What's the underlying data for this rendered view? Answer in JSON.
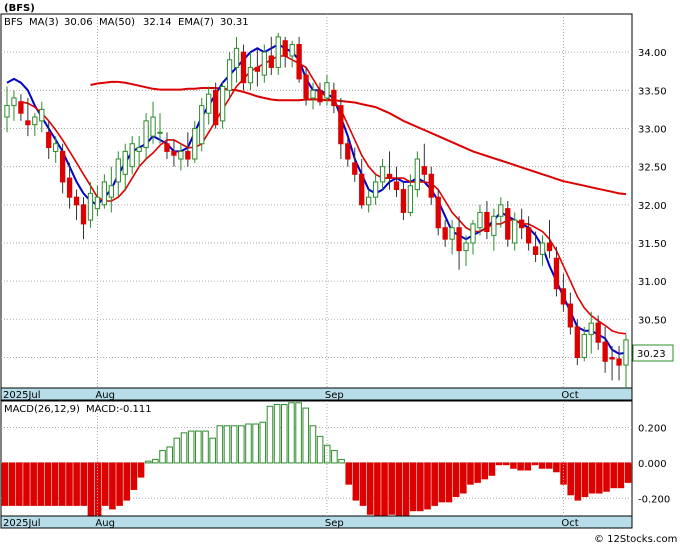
{
  "header": {
    "symbol": "(BFS)",
    "legend_symbol": "BFS",
    "ma3_label": "MA(3)",
    "ma3_value": "30.06",
    "ma50_label": "MA(50)",
    "ma50_value": "32.14",
    "ema7_label": "EMA(7)",
    "ema7_value": "30.31"
  },
  "last_price_label": "30.23",
  "watermark": "© 12Stocks.com",
  "colors": {
    "up": "#2e8b2e",
    "down": "#dd0000",
    "ma3": "#0000cc",
    "ma50": "#dd0000",
    "ema7": "#dd0000",
    "axisband": "#b7dde8",
    "grid": "#aaaaaa"
  },
  "macd_panel": {
    "title": "MACD(26,12,9)",
    "value_label": "MACD:-0.111"
  },
  "chart_data": [
    {
      "type": "candlestick",
      "title": "(BFS)",
      "ylim": [
        29.6,
        34.5
      ],
      "y_ticks": [
        "34.00",
        "33.50",
        "33.00",
        "32.50",
        "32.00",
        "31.50",
        "31.00",
        "30.50",
        "30.00"
      ],
      "x_labels": [
        "2025Jul",
        "Aug",
        "Sep",
        "Oct"
      ],
      "x_label_index": [
        0,
        13,
        46,
        80
      ],
      "grid": "dotted",
      "ohlc": [
        [
          33.15,
          33.55,
          32.95,
          33.3
        ],
        [
          33.3,
          33.5,
          33.1,
          33.4
        ],
        [
          33.35,
          33.45,
          33.1,
          33.2
        ],
        [
          33.1,
          33.4,
          32.9,
          33.05
        ],
        [
          33.05,
          33.2,
          32.9,
          33.15
        ],
        [
          33.1,
          33.35,
          32.95,
          33.25
        ],
        [
          32.95,
          33.1,
          32.6,
          32.75
        ],
        [
          32.7,
          32.9,
          32.55,
          32.8
        ],
        [
          32.7,
          32.8,
          32.15,
          32.3
        ],
        [
          32.35,
          32.55,
          31.95,
          32.1
        ],
        [
          32.1,
          32.2,
          31.8,
          32.0
        ],
        [
          32.0,
          32.1,
          31.55,
          31.75
        ],
        [
          31.8,
          32.3,
          31.7,
          32.15
        ],
        [
          31.95,
          32.25,
          31.85,
          32.1
        ],
        [
          32.0,
          32.4,
          31.95,
          32.3
        ],
        [
          32.1,
          32.5,
          31.9,
          32.25
        ],
        [
          32.3,
          32.7,
          32.1,
          32.6
        ],
        [
          32.4,
          32.8,
          32.2,
          32.7
        ],
        [
          32.5,
          32.9,
          32.4,
          32.8
        ],
        [
          32.7,
          32.9,
          32.5,
          32.75
        ],
        [
          32.75,
          33.2,
          32.6,
          33.1
        ],
        [
          32.9,
          33.35,
          32.8,
          33.15
        ],
        [
          32.95,
          33.2,
          32.8,
          32.95
        ],
        [
          32.8,
          32.95,
          32.6,
          32.7
        ],
        [
          32.7,
          32.85,
          32.5,
          32.65
        ],
        [
          32.6,
          32.8,
          32.45,
          32.7
        ],
        [
          32.7,
          32.95,
          32.5,
          32.6
        ],
        [
          32.6,
          33.1,
          32.55,
          33.0
        ],
        [
          32.8,
          33.4,
          32.7,
          33.3
        ],
        [
          33.2,
          33.55,
          33.05,
          33.45
        ],
        [
          33.5,
          33.6,
          33.0,
          33.05
        ],
        [
          33.1,
          33.6,
          33.0,
          33.55
        ],
        [
          33.5,
          34.0,
          33.4,
          33.9
        ],
        [
          33.8,
          34.2,
          33.6,
          34.05
        ],
        [
          34.0,
          34.1,
          33.5,
          33.6
        ],
        [
          33.6,
          34.0,
          33.5,
          33.8
        ],
        [
          33.8,
          34.05,
          33.55,
          33.75
        ],
        [
          33.7,
          34.1,
          33.6,
          34.0
        ],
        [
          33.95,
          34.2,
          33.7,
          33.8
        ],
        [
          33.8,
          34.25,
          33.7,
          34.2
        ],
        [
          34.15,
          34.2,
          33.8,
          33.95
        ],
        [
          33.95,
          34.15,
          33.8,
          34.1
        ],
        [
          34.1,
          34.2,
          33.6,
          33.65
        ],
        [
          33.7,
          33.8,
          33.3,
          33.4
        ],
        [
          33.4,
          33.6,
          33.25,
          33.5
        ],
        [
          33.5,
          33.6,
          33.3,
          33.35
        ],
        [
          33.4,
          33.7,
          33.3,
          33.6
        ],
        [
          33.5,
          33.6,
          33.2,
          33.3
        ],
        [
          33.3,
          33.4,
          32.6,
          32.8
        ],
        [
          32.8,
          32.9,
          32.5,
          32.6
        ],
        [
          32.55,
          32.75,
          32.3,
          32.4
        ],
        [
          32.4,
          32.6,
          31.95,
          32.0
        ],
        [
          32.0,
          32.2,
          31.9,
          32.1
        ],
        [
          32.1,
          32.4,
          32.0,
          32.3
        ],
        [
          32.3,
          32.6,
          32.2,
          32.5
        ],
        [
          32.4,
          32.7,
          32.2,
          32.35
        ],
        [
          32.3,
          32.5,
          32.1,
          32.2
        ],
        [
          32.2,
          32.3,
          31.8,
          31.9
        ],
        [
          31.9,
          32.4,
          31.85,
          32.25
        ],
        [
          32.2,
          32.7,
          32.1,
          32.6
        ],
        [
          32.5,
          32.8,
          32.3,
          32.4
        ],
        [
          32.4,
          32.5,
          32.0,
          32.1
        ],
        [
          32.1,
          32.2,
          31.6,
          31.7
        ],
        [
          31.7,
          31.8,
          31.45,
          31.55
        ],
        [
          31.55,
          31.8,
          31.35,
          31.7
        ],
        [
          31.7,
          31.85,
          31.15,
          31.4
        ],
        [
          31.4,
          31.6,
          31.2,
          31.5
        ],
        [
          31.5,
          31.8,
          31.35,
          31.75
        ],
        [
          31.7,
          32.0,
          31.6,
          31.9
        ],
        [
          31.9,
          32.05,
          31.55,
          31.65
        ],
        [
          31.6,
          31.95,
          31.4,
          31.85
        ],
        [
          31.85,
          32.1,
          31.7,
          32.0
        ],
        [
          31.95,
          32.05,
          31.45,
          31.55
        ],
        [
          31.5,
          31.9,
          31.4,
          31.8
        ],
        [
          31.8,
          31.95,
          31.55,
          31.7
        ],
        [
          31.7,
          31.85,
          31.4,
          31.5
        ],
        [
          31.45,
          31.65,
          31.25,
          31.35
        ],
        [
          31.35,
          31.6,
          31.2,
          31.5
        ],
        [
          31.5,
          31.8,
          31.3,
          31.4
        ],
        [
          31.3,
          31.45,
          30.8,
          30.9
        ],
        [
          30.9,
          31.1,
          30.6,
          30.7
        ],
        [
          30.7,
          30.85,
          30.3,
          30.4
        ],
        [
          30.4,
          30.5,
          29.9,
          30.0
        ],
        [
          30.0,
          30.4,
          29.95,
          30.3
        ],
        [
          30.3,
          30.6,
          30.05,
          30.45
        ],
        [
          30.45,
          30.55,
          30.1,
          30.2
        ],
        [
          30.2,
          30.4,
          29.8,
          29.95
        ],
        [
          30.0,
          30.15,
          29.7,
          29.98
        ],
        [
          29.98,
          30.15,
          29.7,
          29.9
        ],
        [
          29.9,
          30.3,
          29.6,
          30.23
        ]
      ],
      "series": [
        {
          "name": "MA(50)",
          "values": [
            33.57,
            33.59,
            33.6,
            33.61,
            33.61,
            33.6,
            33.58,
            33.56,
            33.54,
            33.52,
            33.51,
            33.51,
            33.51,
            33.51,
            33.52,
            33.52,
            33.53,
            33.53,
            33.53,
            33.52,
            33.51,
            33.5,
            33.48,
            33.45,
            33.42,
            33.4,
            33.38,
            33.37,
            33.37,
            33.37,
            33.37,
            33.38,
            33.38,
            33.38,
            33.37,
            33.37,
            33.36,
            33.35,
            33.34,
            33.32,
            33.3,
            33.28,
            33.24,
            33.2,
            33.15,
            33.1,
            33.06,
            33.02,
            32.98,
            32.94,
            32.9,
            32.86,
            32.82,
            32.78,
            32.74,
            32.7,
            32.67,
            32.64,
            32.61,
            32.58,
            32.55,
            32.52,
            32.49,
            32.46,
            32.43,
            32.4,
            32.37,
            32.34,
            32.31,
            32.29,
            32.27,
            32.25,
            32.23,
            32.21,
            32.19,
            32.17,
            32.15,
            32.14
          ]
        },
        {
          "name": "MA(3)",
          "values": [
            33.6,
            33.65,
            33.6,
            33.5,
            33.3,
            33.15,
            33.0,
            32.85,
            32.7,
            32.5,
            32.3,
            32.15,
            32.05,
            32.0,
            32.1,
            32.2,
            32.4,
            32.55,
            32.7,
            32.75,
            32.8,
            32.9,
            32.85,
            32.8,
            32.7,
            32.7,
            32.75,
            32.95,
            33.15,
            33.3,
            33.45,
            33.6,
            33.7,
            33.8,
            33.9,
            34.0,
            34.05,
            34.0,
            34.05,
            34.1,
            34.05,
            34.0,
            33.9,
            33.65,
            33.5,
            33.5,
            33.45,
            33.4,
            33.15,
            32.9,
            32.6,
            32.4,
            32.2,
            32.15,
            32.2,
            32.3,
            32.35,
            32.3,
            32.3,
            32.35,
            32.3,
            32.2,
            32.05,
            31.85,
            31.65,
            31.6,
            31.55,
            31.6,
            31.65,
            31.7,
            31.8,
            31.9,
            31.85,
            31.8,
            31.75,
            31.7,
            31.6,
            31.45,
            31.2,
            31.0,
            30.8,
            30.6,
            30.4,
            30.35,
            30.35,
            30.3,
            30.25,
            30.1,
            30.05,
            30.06
          ]
        },
        {
          "name": "EMA(7)",
          "values": [
            33.35,
            33.33,
            33.28,
            33.2,
            33.1,
            32.98,
            32.85,
            32.7,
            32.55,
            32.4,
            32.25,
            32.1,
            32.05,
            32.05,
            32.1,
            32.2,
            32.35,
            32.5,
            32.6,
            32.68,
            32.78,
            32.85,
            32.85,
            32.8,
            32.75,
            32.75,
            32.8,
            32.95,
            33.1,
            33.25,
            33.4,
            33.55,
            33.65,
            33.75,
            33.8,
            33.85,
            33.9,
            33.95,
            33.95,
            33.9,
            33.85,
            33.8,
            33.65,
            33.5,
            33.4,
            33.35,
            33.25,
            33.05,
            32.85,
            32.65,
            32.5,
            32.4,
            32.35,
            32.35,
            32.35,
            32.35,
            32.3,
            32.3,
            32.3,
            32.28,
            32.2,
            32.05,
            31.9,
            31.8,
            31.7,
            31.65,
            31.65,
            31.7,
            31.75,
            31.75,
            31.8,
            31.8,
            31.75,
            31.75,
            31.7,
            31.65,
            31.55,
            31.4,
            31.2,
            31.0,
            30.8,
            30.65,
            30.55,
            30.48,
            30.42,
            30.35,
            30.32,
            30.31
          ]
        }
      ]
    },
    {
      "type": "bar",
      "title": "MACD(26,12,9)",
      "ylim": [
        -0.3,
        0.35
      ],
      "y_ticks": [
        "0.200",
        "0.000",
        "-0.200"
      ],
      "x_labels": [
        "2025Jul",
        "Aug",
        "Sep",
        "Oct"
      ],
      "values": [
        -0.24,
        -0.24,
        -0.24,
        -0.24,
        -0.24,
        -0.24,
        -0.24,
        -0.24,
        -0.24,
        -0.24,
        -0.24,
        -0.24,
        -0.3,
        -0.3,
        -0.24,
        -0.26,
        -0.24,
        -0.21,
        -0.15,
        -0.08,
        0.01,
        0.02,
        0.07,
        0.09,
        0.14,
        0.17,
        0.18,
        0.18,
        0.18,
        0.14,
        0.21,
        0.21,
        0.21,
        0.21,
        0.22,
        0.22,
        0.23,
        0.32,
        0.33,
        0.33,
        0.34,
        0.34,
        0.31,
        0.21,
        0.15,
        0.1,
        0.07,
        0.02,
        -0.12,
        -0.21,
        -0.24,
        -0.29,
        -0.33,
        -0.33,
        -0.29,
        -0.33,
        -0.34,
        -0.27,
        -0.27,
        -0.26,
        -0.24,
        -0.22,
        -0.22,
        -0.19,
        -0.17,
        -0.12,
        -0.11,
        -0.09,
        -0.07,
        -0.01,
        -0.01,
        -0.03,
        -0.04,
        -0.04,
        -0.01,
        -0.03,
        -0.03,
        -0.05,
        -0.12,
        -0.18,
        -0.21,
        -0.19,
        -0.17,
        -0.17,
        -0.16,
        -0.14,
        -0.14,
        -0.11
      ]
    }
  ]
}
